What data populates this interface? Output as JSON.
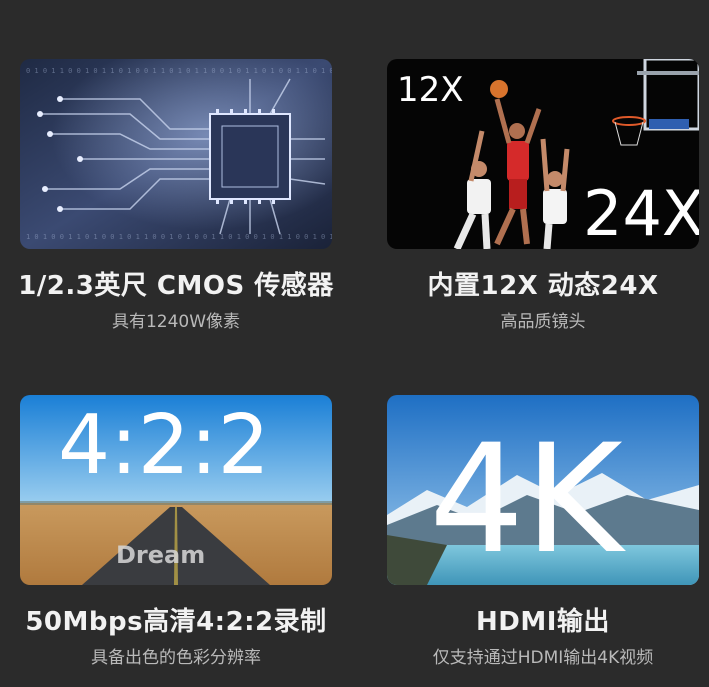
{
  "features": [
    {
      "title": "1/2.3英尺 CMOS 传感器",
      "subtitle": "具有1240W像素",
      "image": "cmos-chip-circuit"
    },
    {
      "title": "内置12X  动态24X",
      "subtitle": "高品质镜头",
      "image": "basketball-players",
      "overlay_small": "12X",
      "overlay_large": "24X"
    },
    {
      "title": "50Mbps高清4:2:2录制",
      "subtitle": "具备出色的色彩分辨率",
      "image": "desert-road-dream",
      "overlay": "4:2:2",
      "road_text": "Dream"
    },
    {
      "title": "HDMI输出",
      "subtitle": "仅支持通过HDMI输出4K视频",
      "image": "mountain-lake",
      "overlay": "4K"
    }
  ],
  "colors": {
    "background": "#2b2b2b",
    "title": "#f2f2f2",
    "subtitle": "#b9b9b9"
  }
}
